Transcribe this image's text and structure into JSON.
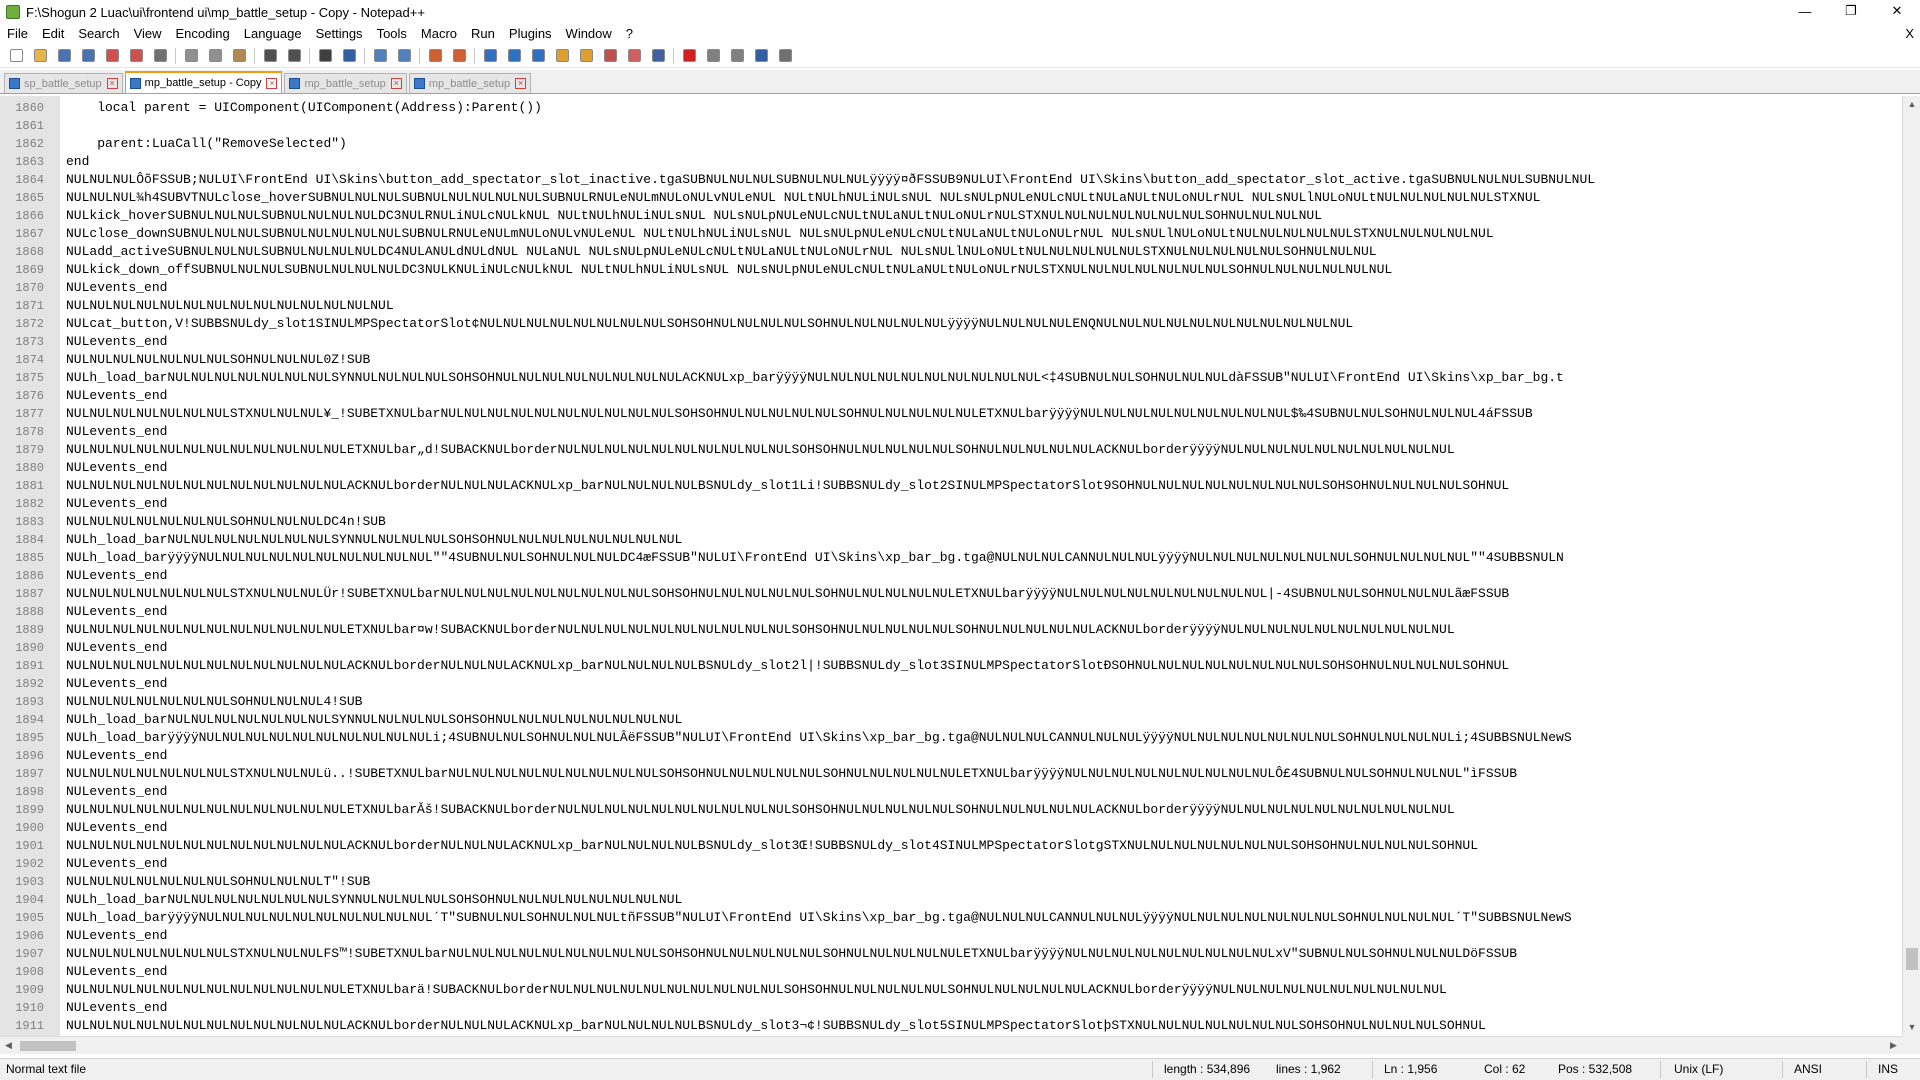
{
  "window": {
    "title": "F:\\Shogun 2 Luac\\ui\\frontend ui\\mp_battle_setup - Copy - Notepad++",
    "minimize": "—",
    "maximize": "❐",
    "close": "✕"
  },
  "menu": {
    "items": [
      "File",
      "Edit",
      "Search",
      "View",
      "Encoding",
      "Language",
      "Settings",
      "Tools",
      "Macro",
      "Run",
      "Plugins",
      "Window",
      "?"
    ],
    "close_label": "X"
  },
  "toolbar": {
    "buttons": [
      {
        "name": "new-file-icon",
        "color": "#ffffff"
      },
      {
        "name": "open-file-icon",
        "color": "#e8b44a"
      },
      {
        "name": "save-icon",
        "color": "#4a72b0"
      },
      {
        "name": "save-all-icon",
        "color": "#4a72b0"
      },
      {
        "name": "close-file-icon",
        "color": "#d05050"
      },
      {
        "name": "close-all-icon",
        "color": "#d05050"
      },
      {
        "name": "print-icon",
        "color": "#707070"
      },
      {
        "name": "sep"
      },
      {
        "name": "cut-icon",
        "color": "#909090"
      },
      {
        "name": "copy-icon",
        "color": "#909090"
      },
      {
        "name": "paste-icon",
        "color": "#b08a50"
      },
      {
        "name": "sep"
      },
      {
        "name": "undo-icon",
        "color": "#505050"
      },
      {
        "name": "redo-icon",
        "color": "#505050"
      },
      {
        "name": "sep"
      },
      {
        "name": "find-icon",
        "color": "#404040"
      },
      {
        "name": "replace-icon",
        "color": "#3060a0"
      },
      {
        "name": "sep"
      },
      {
        "name": "zoom-in-icon",
        "color": "#5080c0"
      },
      {
        "name": "zoom-out-icon",
        "color": "#5080c0"
      },
      {
        "name": "sep"
      },
      {
        "name": "sync-vertical-icon",
        "color": "#d06030"
      },
      {
        "name": "sync-horizontal-icon",
        "color": "#d06030"
      },
      {
        "name": "sep"
      },
      {
        "name": "word-wrap-icon",
        "color": "#3070c0"
      },
      {
        "name": "show-all-chars-icon",
        "color": "#3070c0"
      },
      {
        "name": "indent-guide-icon",
        "color": "#3070c0"
      },
      {
        "name": "udl-icon",
        "color": "#e0a030"
      },
      {
        "name": "doc-map-icon",
        "color": "#e0a030"
      },
      {
        "name": "function-list-icon",
        "color": "#c05050"
      },
      {
        "name": "folder-workspace-icon",
        "color": "#d06060"
      },
      {
        "name": "monitoring-icon",
        "color": "#4060a0"
      },
      {
        "name": "sep"
      },
      {
        "name": "record-macro-icon",
        "color": "#d02020"
      },
      {
        "name": "stop-record-icon",
        "color": "#808080"
      },
      {
        "name": "play-macro-icon",
        "color": "#808080"
      },
      {
        "name": "run-macro-multiple-icon",
        "color": "#3060a0"
      },
      {
        "name": "save-macro-icon",
        "color": "#707070"
      }
    ]
  },
  "tabs": [
    {
      "label": "sp_battle_setup",
      "active": false
    },
    {
      "label": "mp_battle_setup - Copy",
      "active": true
    },
    {
      "label": "mp_battle_setup",
      "active": false
    },
    {
      "label": "mp_battle_setup",
      "active": false
    }
  ],
  "editor": {
    "lines": [
      {
        "n": "1860",
        "t": "    local parent = UIComponent(UIComponent(Address):Parent())"
      },
      {
        "n": "1861",
        "t": ""
      },
      {
        "n": "1862",
        "t": "    parent:LuaCall(\"RemoveSelected\")"
      },
      {
        "n": "1863",
        "t": "end"
      },
      {
        "n": "1864",
        "t": "NULNULNULÔõFSSUB;NULUI\\FrontEnd UI\\Skins\\button_add_spectator_slot_inactive.tgaSUBNULNULNULSUBNULNULNULÿÿÿÿ¤ðFSSUB9NULUI\\FrontEnd UI\\Skins\\button_add_spectator_slot_active.tgaSUBNULNULNULSUBNULNUL"
      },
      {
        "n": "1865",
        "t": "NULNULNUL¾h4SUBVTNULclose_hoverSUBNULNULNULSUBNULNULNULNULNULSUBNULRNULeNULmNULoNULvNULeNUL NULtNULhNULiNULsNUL NULsNULpNULeNULcNULtNULaNULtNULoNULrNUL NULsNULlNULoNULtNULNULNULNULNULSTXNUL"
      },
      {
        "n": "1866",
        "t": "NULkick_hoverSUBNULNULNULSUBNULNULNULNULDC3NULRNULiNULcNULkNUL NULtNULhNULiNULsNUL NULsNULpNULeNULcNULtNULaNULtNULoNULrNULSTXNULNULNULNULNULNULNULSOHNULNULNULNUL"
      },
      {
        "n": "1867",
        "t": "NULclose_downSUBNULNULNULSUBNULNULNULNULNULSUBNULRNULeNULmNULoNULvNULeNUL NULtNULhNULiNULsNUL NULsNULpNULeNULcNULtNULaNULtNULoNULrNUL NULsNULlNULoNULtNULNULNULNULNULSTXNULNULNULNULNUL"
      },
      {
        "n": "1868",
        "t": "NULadd_activeSUBNULNULNULSUBNULNULNULNULDC4NULANULdNULdNUL NULaNUL NULsNULpNULeNULcNULtNULaNULtNULoNULrNUL NULsNULlNULoNULtNULNULNULNULNULSTXNULNULNULNULNULSOHNULNULNUL"
      },
      {
        "n": "1869",
        "t": "NULkick_down_offSUBNULNULNULSUBNULNULNULNULDC3NULKNULiNULcNULkNUL NULtNULhNULiNULsNUL NULsNULpNULeNULcNULtNULaNULtNULoNULrNULSTXNULNULNULNULNULNULNULSOHNULNULNULNULNULNUL"
      },
      {
        "n": "1870",
        "t": "NULevents_end"
      },
      {
        "n": "1871",
        "t": "NULNULNULNULNULNULNULNULNULNULNULNULNULNUL"
      },
      {
        "n": "1872",
        "t": "NULcat_button,V!SUBBSNULdy_slot1SINULMPSpectatorSlot¢NULNULNULNULNULNULNULNULSOHSOHNULNULNULNULSOHNULNULNULNULNULÿÿÿÿNULNULNULNULENQNULNULNULNULNULNULNULNULNULNULNUL"
      },
      {
        "n": "1873",
        "t": "NULevents_end"
      },
      {
        "n": "1874",
        "t": "NULNULNULNULNULNULNULSOHNULNULNUL0Z!SUB"
      },
      {
        "n": "1875",
        "t": "NULh_load_barNULNULNULNULNULNULNULSYNNULNULNULNULSOHSOHNULNULNULNULNULNULNULNULACKNULxp_barÿÿÿÿNULNULNULNULNULNULNULNULNULNUL<‡4SUBNULNULSOHNULNULNULdàFSSUB\"NULUI\\FrontEnd UI\\Skins\\xp_bar_bg.t"
      },
      {
        "n": "1876",
        "t": "NULevents_end"
      },
      {
        "n": "1877",
        "t": "NULNULNULNULNULNULNULSTXNULNULNUL¥_!SUBETXNULbarNULNULNULNULNULNULNULNULNULNULSOHSOHNULNULNULNULNULSOHNULNULNULNULNULETXNULbarÿÿÿÿNULNULNULNULNULNULNULNULNUL$‰4SUBNULNULSOHNULNULNUL4áFSSUB"
      },
      {
        "n": "1878",
        "t": "NULevents_end"
      },
      {
        "n": "1879",
        "t": "NULNULNULNULNULNULNULNULNULNULNULNULETXNULbar„d!SUBACKNULborderNULNULNULNULNULNULNULNULNULNULSOHSOHNULNULNULNULNULSOHNULNULNULNULNULACKNULborderÿÿÿÿNULNULNULNULNULNULNULNULNULNUL"
      },
      {
        "n": "1880",
        "t": "NULevents_end"
      },
      {
        "n": "1881",
        "t": "NULNULNULNULNULNULNULNULNULNULNULNULACKNULborderNULNULNULACKNULxp_barNULNULNULNULBSNULdy_slot1Li!SUBBSNULdy_slot2SINULMPSpectatorSlot9SOHNULNULNULNULNULNULNULNULSOHSOHNULNULNULNULSOHNUL"
      },
      {
        "n": "1882",
        "t": "NULevents_end"
      },
      {
        "n": "1883",
        "t": "NULNULNULNULNULNULNULSOHNULNULNULDC4n!SUB"
      },
      {
        "n": "1884",
        "t": "NULh_load_barNULNULNULNULNULNULNULSYNNULNULNULNULSOHSOHNULNULNULNULNULNULNULNUL"
      },
      {
        "n": "1885",
        "t": "NULh_load_barÿÿÿÿNULNULNULNULNULNULNULNULNULNUL\"\"4SUBNULNULSOHNULNULNULDC4æFSSUB\"NULUI\\FrontEnd UI\\Skins\\xp_bar_bg.tga@NULNULNULCANNULNULNULÿÿÿÿNULNULNULNULNULNULNULSOHNULNULNULNUL\"\"4SUBBSNULN"
      },
      {
        "n": "1886",
        "t": "NULevents_end"
      },
      {
        "n": "1887",
        "t": "NULNULNULNULNULNULNULSTXNULNULNULÜr!SUBETXNULbarNULNULNULNULNULNULNULNULNULSOHSOHNULNULNULNULNULSOHNULNULNULNULNULETXNULbarÿÿÿÿNULNULNULNULNULNULNULNULNUL|-4SUBNULNULSOHNULNULNULãæFSSUB"
      },
      {
        "n": "1888",
        "t": "NULevents_end"
      },
      {
        "n": "1889",
        "t": "NULNULNULNULNULNULNULNULNULNULNULNULETXNULbar¤w!SUBACKNULborderNULNULNULNULNULNULNULNULNULNULSOHSOHNULNULNULNULNULSOHNULNULNULNULNULACKNULborderÿÿÿÿNULNULNULNULNULNULNULNULNULNUL"
      },
      {
        "n": "1890",
        "t": "NULevents_end"
      },
      {
        "n": "1891",
        "t": "NULNULNULNULNULNULNULNULNULNULNULNULACKNULborderNULNULNULACKNULxp_barNULNULNULNULBSNULdy_slot2l|!SUBBSNULdy_slot3SINULMPSpectatorSlotÐSOHNULNULNULNULNULNULNULNULSOHSOHNULNULNULNULSOHNUL"
      },
      {
        "n": "1892",
        "t": "NULevents_end"
      },
      {
        "n": "1893",
        "t": "NULNULNULNULNULNULNULSOHNULNULNUL4!SUB"
      },
      {
        "n": "1894",
        "t": "NULh_load_barNULNULNULNULNULNULNULSYNNULNULNULNULSOHSOHNULNULNULNULNULNULNULNUL"
      },
      {
        "n": "1895",
        "t": "NULh_load_barÿÿÿÿNULNULNULNULNULNULNULNULNULNULi;4SUBNULNULSOHNULNULNULÂëFSSUB\"NULUI\\FrontEnd UI\\Skins\\xp_bar_bg.tga@NULNULNULCANNULNULNULÿÿÿÿNULNULNULNULNULNULNULSOHNULNULNULNULi;4SUBBSNULNewS"
      },
      {
        "n": "1896",
        "t": "NULevents_end"
      },
      {
        "n": "1897",
        "t": "NULNULNULNULNULNULNULSTXNULNULNULü..!SUBETXNULbarNULNULNULNULNULNULNULNULNULSOHSOHNULNULNULNULNULSOHNULNULNULNULNULETXNULbarÿÿÿÿNULNULNULNULNULNULNULNULNULÔ£4SUBNULNULSOHNULNULNUL\"ìFSSUB"
      },
      {
        "n": "1898",
        "t": "NULevents_end"
      },
      {
        "n": "1899",
        "t": "NULNULNULNULNULNULNULNULNULNULNULNULETXNULbarĂš!SUBACKNULborderNULNULNULNULNULNULNULNULNULNULSOHSOHNULNULNULNULNULSOHNULNULNULNULNULACKNULborderÿÿÿÿNULNULNULNULNULNULNULNULNULNUL"
      },
      {
        "n": "1900",
        "t": "NULevents_end"
      },
      {
        "n": "1901",
        "t": "NULNULNULNULNULNULNULNULNULNULNULNULACKNULborderNULNULNULACKNULxp_barNULNULNULNULBSNULdy_slot3Œ!SUBBSNULdy_slot4SINULMPSpectatorSlotgSTXNULNULNULNULNULNULNULSOHSOHNULNULNULNULSOHNUL"
      },
      {
        "n": "1902",
        "t": "NULevents_end"
      },
      {
        "n": "1903",
        "t": "NULNULNULNULNULNULNULSOHNULNULNULT\"!SUB"
      },
      {
        "n": "1904",
        "t": "NULh_load_barNULNULNULNULNULNULNULSYNNULNULNULNULSOHSOHNULNULNULNULNULNULNULNUL"
      },
      {
        "n": "1905",
        "t": "NULh_load_barÿÿÿÿNULNULNULNULNULNULNULNULNULNUL´T\"SUBNULNULSOHNULNULNULtñFSSUB\"NULUI\\FrontEnd UI\\Skins\\xp_bar_bg.tga@NULNULNULCANNULNULNULÿÿÿÿNULNULNULNULNULNULNULSOHNULNULNULNUL´T\"SUBBSNULNewS"
      },
      {
        "n": "1906",
        "t": "NULevents_end"
      },
      {
        "n": "1907",
        "t": "NULNULNULNULNULNULNULSTXNULNULNULFS™!SUBETXNULbarNULNULNULNULNULNULNULNULNULSOHSOHNULNULNULNULNULSOHNULNULNULNULNULETXNULbarÿÿÿÿNULNULNULNULNULNULNULNULNULxV\"SUBNULNULSOHNULNULNULDöFSSUB"
      },
      {
        "n": "1908",
        "t": "NULevents_end"
      },
      {
        "n": "1909",
        "t": "NULNULNULNULNULNULNULNULNULNULNULNULETXNULbarä!SUBACKNULborderNULNULNULNULNULNULNULNULNULNULSOHSOHNULNULNULNULNULSOHNULNULNULNULNULACKNULborderÿÿÿÿNULNULNULNULNULNULNULNULNULNUL"
      },
      {
        "n": "1910",
        "t": "NULevents_end"
      },
      {
        "n": "1911",
        "t": "NULNULNULNULNULNULNULNULNULNULNULNULACKNULborderNULNULNULACKNULxp_barNULNULNULNULBSNULdy_slot3¬¢!SUBBSNULdy_slot5SINULMPSpectatorSlotþSTXNULNULNULNULNULNULNULSOHSOHNULNULNULNULSOHNUL"
      }
    ]
  },
  "scroll": {
    "up": "▲",
    "down": "▼",
    "left": "◀",
    "right": "▶"
  },
  "status": {
    "file_type": "Normal text file",
    "length": "length : 534,896",
    "lines": "lines : 1,962",
    "ln": "Ln : 1,956",
    "col": "Col : 62",
    "pos": "Pos : 532,508",
    "eol": "Unix (LF)",
    "encoding": "ANSI",
    "mode": "INS"
  }
}
